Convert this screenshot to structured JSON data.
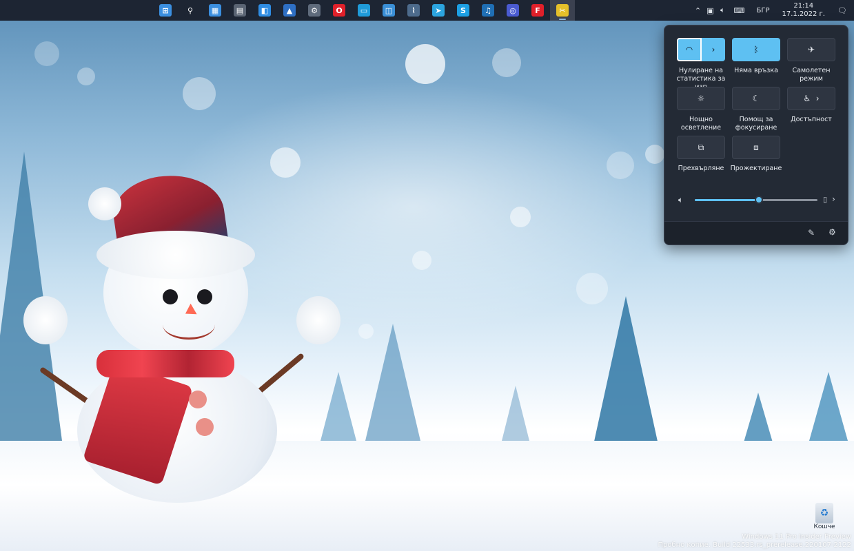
{
  "taskbar": {
    "apps": [
      {
        "name": "start-button",
        "icon": "windows-logo-icon",
        "glyph": "⊞",
        "color": "#3b8fe0",
        "active": false
      },
      {
        "name": "search-button",
        "icon": "search-icon",
        "glyph": "⚲",
        "color": "#1d2533",
        "active": false
      },
      {
        "name": "widgets-button",
        "icon": "widgets-icon",
        "glyph": "▦",
        "color": "#3b8fe0",
        "active": false
      },
      {
        "name": "calculator-app",
        "icon": "calculator-icon",
        "glyph": "▤",
        "color": "#5a6473",
        "active": false
      },
      {
        "name": "store-app",
        "icon": "store-icon",
        "glyph": "◧",
        "color": "#2f8de4",
        "active": false
      },
      {
        "name": "photos-app",
        "icon": "photos-icon",
        "glyph": "▲",
        "color": "#2e6fc4",
        "active": false
      },
      {
        "name": "settings-app",
        "icon": "gear-icon",
        "glyph": "⚙",
        "color": "#5f6b7c",
        "active": false
      },
      {
        "name": "opera-app",
        "icon": "opera-icon",
        "glyph": "O",
        "color": "#e0202a",
        "active": false
      },
      {
        "name": "remote-desktop-app",
        "icon": "monitor-icon",
        "glyph": "▭",
        "color": "#1f9bd9",
        "active": false
      },
      {
        "name": "control-panel-app",
        "icon": "control-panel-icon",
        "glyph": "◫",
        "color": "#3a8fd6",
        "active": false
      },
      {
        "name": "performance-app",
        "icon": "chart-icon",
        "glyph": "⌇",
        "color": "#4d6b8c",
        "active": false
      },
      {
        "name": "telegram-app",
        "icon": "telegram-icon",
        "glyph": "➤",
        "color": "#2ca5e0",
        "active": false
      },
      {
        "name": "skype-app",
        "icon": "skype-icon",
        "glyph": "S",
        "color": "#1c9fe3",
        "active": false
      },
      {
        "name": "audio-app",
        "icon": "headphones-icon",
        "glyph": "♫",
        "color": "#1f6fb5",
        "active": false
      },
      {
        "name": "media-player-app",
        "icon": "media-player-icon",
        "glyph": "◎",
        "color": "#4a5bd1",
        "active": false
      },
      {
        "name": "foxit-app",
        "icon": "foxit-icon",
        "glyph": "F",
        "color": "#e0202a",
        "active": false
      },
      {
        "name": "snipping-app",
        "icon": "snipping-icon",
        "glyph": "✂",
        "color": "#e6c02a",
        "active": true
      }
    ],
    "tray": {
      "language": "БГР",
      "time": "21:14",
      "date": "17.1.2022 г."
    }
  },
  "quick_settings": {
    "wifi": {
      "label": "Нулиране на статистика за изп",
      "on": true
    },
    "bluetooth": {
      "label": "Няма връзка",
      "on": true
    },
    "airplane": {
      "label": "Самолетен режим",
      "on": false
    },
    "night_light": {
      "label": "Нощно осветление",
      "on": false
    },
    "focus_assist": {
      "label": "Помощ за фокусиране",
      "on": false
    },
    "accessibility": {
      "label": "Достъпност",
      "on": false
    },
    "cast": {
      "label": "Прехвърляне",
      "on": false
    },
    "project": {
      "label": "Прожектиране",
      "on": false
    },
    "volume_level": 0.52
  },
  "desktop": {
    "recycle_bin_label": "Кошче",
    "watermark_line1": "Windows 11 Pro Insider Preview",
    "watermark_line2": "Пробно копие. Build 22533.rs_prerelease.220107-2122"
  },
  "colors": {
    "accent": "#5ec0f2",
    "taskbar": "#1d2533",
    "panel": "#232a35"
  }
}
